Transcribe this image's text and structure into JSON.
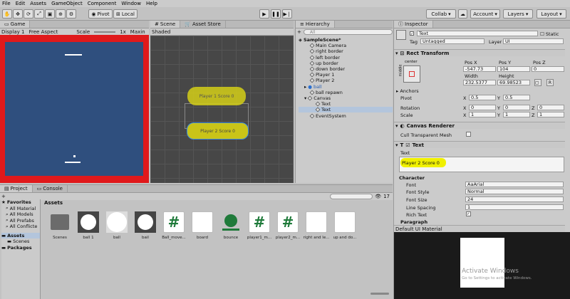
{
  "menu": [
    "File",
    "Edit",
    "Assets",
    "GameObject",
    "Component",
    "Window",
    "Help"
  ],
  "toolbar": {
    "pivot": "Pivot",
    "local": "Local",
    "collab": "Collab",
    "account": "Account",
    "layers": "Layers",
    "layout": "Layout"
  },
  "game": {
    "tab": "Game",
    "display": "Display 1",
    "aspect": "Free Aspect",
    "scale_label": "Scale",
    "scale_value": "1x",
    "maximize": "Maxin"
  },
  "scene": {
    "tab": "Scene",
    "asset_store_tab": "Asset Store",
    "shading": "Shaded",
    "label_player1": "Player 1 Score 0",
    "label_player2": "Player 2 Score 0"
  },
  "hierarchy": {
    "tab": "Hierarchy",
    "add": "+",
    "search_placeholder": "All",
    "scene_name": "SampleScene*",
    "items": [
      "Main Camera",
      "right border",
      "left border",
      "up border",
      "down border",
      "Player 1",
      "Player 2",
      "ball",
      "ball repawn",
      "Canvas",
      "Text",
      "Text",
      "EventSystem"
    ]
  },
  "inspector": {
    "tab": "Inspector",
    "object_name": "Text",
    "static_label": "Static",
    "tag_label": "Tag",
    "tag_value": "Untagged",
    "layer_label": "Layer",
    "layer_value": "UI",
    "rect_transform": "Rect Transform",
    "anchor_preset": "center",
    "anchor_side": "middle",
    "pos_x_label": "Pos X",
    "pos_y_label": "Pos Y",
    "pos_z_label": "Pos Z",
    "pos_x": "-547.73",
    "pos_y": "104",
    "pos_z": "0",
    "width_label": "Width",
    "height_label": "Height",
    "width": "232.5377",
    "height": "69.98523",
    "r_button": "R",
    "anchors": "Anchors",
    "pivot_label": "Pivot",
    "pivot_x": "0.5",
    "pivot_y": "0.5",
    "rotation_label": "Rotation",
    "rot_x": "0",
    "rot_y": "0",
    "rot_z": "0",
    "scale_label": "Scale",
    "scale_x": "1",
    "scale_y": "1",
    "scale_z": "1",
    "canvas_renderer": "Canvas Renderer",
    "cull_label": "Cull Transparent Mesh",
    "text_component": "Text",
    "text_label": "Text",
    "text_value": "Player 2 Score 0",
    "character": "Character",
    "font_label": "Font",
    "font_value": "Arial",
    "font_style_label": "Font Style",
    "font_style_value": "Normal",
    "font_size_label": "Font Size",
    "font_size_value": "24",
    "line_spacing_label": "Line Spacing",
    "line_spacing_value": "1",
    "rich_text_label": "Rich Text",
    "paragraph": "Paragraph",
    "material": "Default UI Material",
    "watermark_title": "Activate Windows",
    "watermark_sub": "Go to Settings to activate Windows."
  },
  "project": {
    "tab_project": "Project",
    "tab_console": "Console",
    "add": "+",
    "count": "17",
    "favorites": "Favorites",
    "fav_items": [
      "All Material",
      "All Models",
      "All Prefabs",
      "All Conflicte"
    ],
    "assets": "Assets",
    "asset_children": [
      "Scenes"
    ],
    "packages": "Packages",
    "breadcrumb": "Assets",
    "files": [
      "Scenes",
      "ball 1",
      "ball",
      "bail",
      "Ball_move...",
      "board",
      "bounce",
      "player1_m...",
      "player2_m...",
      "right and le...",
      "up and do..."
    ]
  },
  "colors": {
    "game_bg": "#2f4f7e",
    "game_frame": "#e0191b",
    "highlight": "#f0f000",
    "scene_bg": "#474747"
  }
}
